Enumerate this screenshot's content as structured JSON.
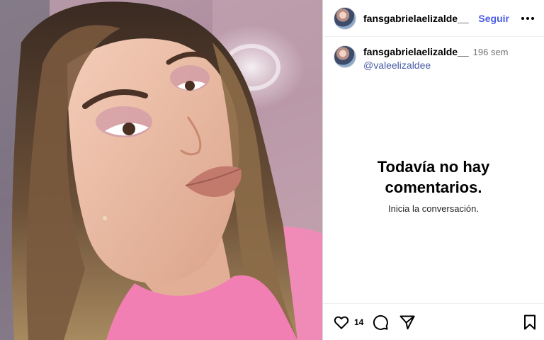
{
  "post": {
    "author": "fansgabrielaelizalde__",
    "follow_label": "Seguir",
    "more_icon": "more-horizontal-icon"
  },
  "caption": {
    "username": "fansgabrielaelizalde__",
    "time": "196 sem",
    "mention": "@valeelizaldee"
  },
  "comments": {
    "empty_title": "Todavía no hay comentarios.",
    "empty_subtitle": "Inicia la conversación."
  },
  "actions": {
    "like_icon": "heart-icon",
    "like_count": "14",
    "comment_icon": "comment-icon",
    "share_icon": "share-icon",
    "save_icon": "bookmark-icon"
  },
  "colors": {
    "accent": "#4a5be6",
    "mention": "#4a5da6",
    "muted": "#737373",
    "shirt": "#f27fb3"
  }
}
